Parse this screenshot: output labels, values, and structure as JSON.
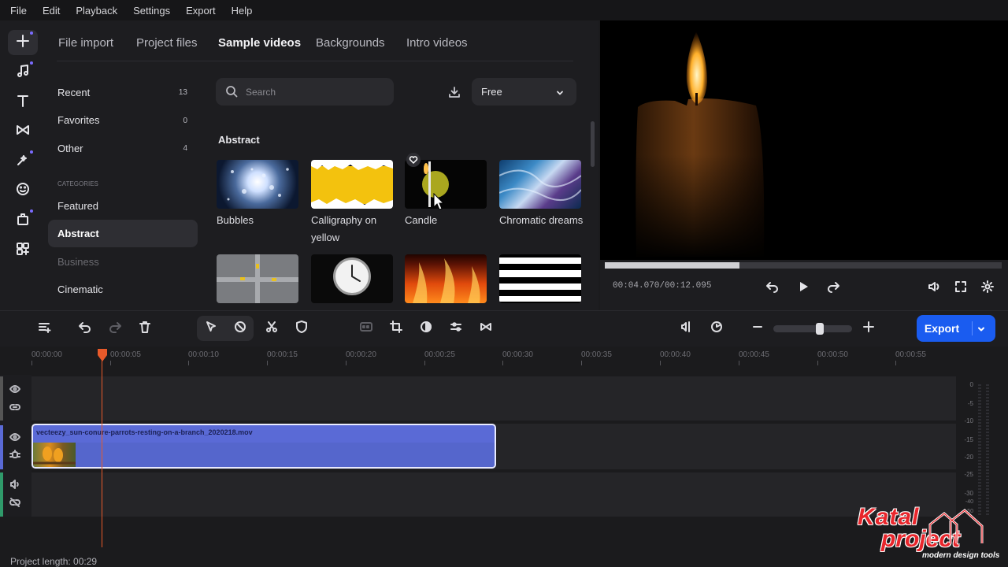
{
  "menu": [
    "File",
    "Edit",
    "Playback",
    "Settings",
    "Export",
    "Help"
  ],
  "rail_icons": [
    "plus-icon",
    "music-icon",
    "text-icon",
    "transition-icon",
    "effects-icon",
    "sticker-icon",
    "elements-icon",
    "apps-icon"
  ],
  "library": {
    "tabs": [
      "File import",
      "Project files",
      "Sample videos",
      "Backgrounds",
      "Intro videos"
    ],
    "active_tab": "Sample videos",
    "sidebar": [
      {
        "label": "Recent",
        "count": "13"
      },
      {
        "label": "Favorites",
        "count": "0"
      },
      {
        "label": "Other",
        "count": "4"
      }
    ],
    "categories_heading": "CATEGORIES",
    "categories": [
      "Featured",
      "Abstract",
      "Business",
      "Cinematic"
    ],
    "selected_category": "Abstract",
    "search_placeholder": "Search",
    "filter_value": "Free",
    "section_title": "Abstract",
    "videos": [
      {
        "label": "Bubbles"
      },
      {
        "label": "Calligraphy on yellow"
      },
      {
        "label": "Candle"
      },
      {
        "label": "Chromatic dreams"
      },
      {
        "label": ""
      },
      {
        "label": ""
      },
      {
        "label": ""
      },
      {
        "label": ""
      }
    ]
  },
  "preview": {
    "time_current": "00:04.070",
    "time_separator": "/",
    "time_total": "00:12.095",
    "progress_fraction": 0.34
  },
  "toolbar": {
    "export_label": "Export",
    "zoom_fraction": 0.6
  },
  "timeline": {
    "ruler": [
      "00:00:00",
      "00:00:05",
      "00:00:10",
      "00:00:15",
      "00:00:20",
      "00:00:25",
      "00:00:30",
      "00:00:35",
      "00:00:40",
      "00:00:45",
      "00:00:50",
      "00:00:55"
    ],
    "clip_name": "vecteezy_sun-conure-parrots-resting-on-a-branch_2020218.mov",
    "meter_scale": [
      "0",
      "-5",
      "-10",
      "-15",
      "-20",
      "-25",
      "-30",
      "-40",
      "-50"
    ],
    "project_length": "Project length: 00:29"
  },
  "watermark": {
    "line1": "Katal",
    "line2": "project",
    "tagline": "modern design tools"
  },
  "colors": {
    "accent": "#1a5cf0",
    "clip": "#5a6ad6",
    "playhead": "#e85a2a",
    "watermark": "#e8262c"
  }
}
